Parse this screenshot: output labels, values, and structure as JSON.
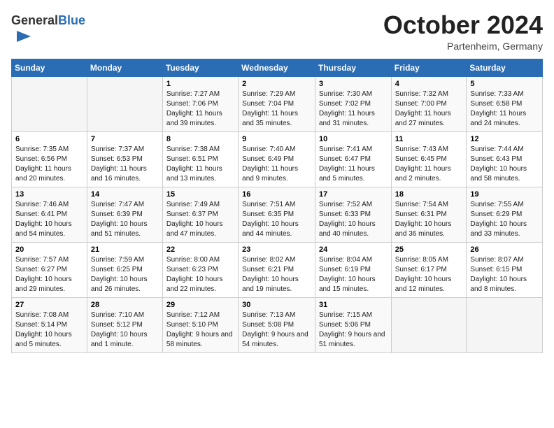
{
  "header": {
    "logo_general": "General",
    "logo_blue": "Blue",
    "month": "October 2024",
    "location": "Partenheim, Germany"
  },
  "weekdays": [
    "Sunday",
    "Monday",
    "Tuesday",
    "Wednesday",
    "Thursday",
    "Friday",
    "Saturday"
  ],
  "rows": [
    [
      {
        "day": "",
        "sunrise": "",
        "sunset": "",
        "daylight": ""
      },
      {
        "day": "",
        "sunrise": "",
        "sunset": "",
        "daylight": ""
      },
      {
        "day": "1",
        "sunrise": "Sunrise: 7:27 AM",
        "sunset": "Sunset: 7:06 PM",
        "daylight": "Daylight: 11 hours and 39 minutes."
      },
      {
        "day": "2",
        "sunrise": "Sunrise: 7:29 AM",
        "sunset": "Sunset: 7:04 PM",
        "daylight": "Daylight: 11 hours and 35 minutes."
      },
      {
        "day": "3",
        "sunrise": "Sunrise: 7:30 AM",
        "sunset": "Sunset: 7:02 PM",
        "daylight": "Daylight: 11 hours and 31 minutes."
      },
      {
        "day": "4",
        "sunrise": "Sunrise: 7:32 AM",
        "sunset": "Sunset: 7:00 PM",
        "daylight": "Daylight: 11 hours and 27 minutes."
      },
      {
        "day": "5",
        "sunrise": "Sunrise: 7:33 AM",
        "sunset": "Sunset: 6:58 PM",
        "daylight": "Daylight: 11 hours and 24 minutes."
      }
    ],
    [
      {
        "day": "6",
        "sunrise": "Sunrise: 7:35 AM",
        "sunset": "Sunset: 6:56 PM",
        "daylight": "Daylight: 11 hours and 20 minutes."
      },
      {
        "day": "7",
        "sunrise": "Sunrise: 7:37 AM",
        "sunset": "Sunset: 6:53 PM",
        "daylight": "Daylight: 11 hours and 16 minutes."
      },
      {
        "day": "8",
        "sunrise": "Sunrise: 7:38 AM",
        "sunset": "Sunset: 6:51 PM",
        "daylight": "Daylight: 11 hours and 13 minutes."
      },
      {
        "day": "9",
        "sunrise": "Sunrise: 7:40 AM",
        "sunset": "Sunset: 6:49 PM",
        "daylight": "Daylight: 11 hours and 9 minutes."
      },
      {
        "day": "10",
        "sunrise": "Sunrise: 7:41 AM",
        "sunset": "Sunset: 6:47 PM",
        "daylight": "Daylight: 11 hours and 5 minutes."
      },
      {
        "day": "11",
        "sunrise": "Sunrise: 7:43 AM",
        "sunset": "Sunset: 6:45 PM",
        "daylight": "Daylight: 11 hours and 2 minutes."
      },
      {
        "day": "12",
        "sunrise": "Sunrise: 7:44 AM",
        "sunset": "Sunset: 6:43 PM",
        "daylight": "Daylight: 10 hours and 58 minutes."
      }
    ],
    [
      {
        "day": "13",
        "sunrise": "Sunrise: 7:46 AM",
        "sunset": "Sunset: 6:41 PM",
        "daylight": "Daylight: 10 hours and 54 minutes."
      },
      {
        "day": "14",
        "sunrise": "Sunrise: 7:47 AM",
        "sunset": "Sunset: 6:39 PM",
        "daylight": "Daylight: 10 hours and 51 minutes."
      },
      {
        "day": "15",
        "sunrise": "Sunrise: 7:49 AM",
        "sunset": "Sunset: 6:37 PM",
        "daylight": "Daylight: 10 hours and 47 minutes."
      },
      {
        "day": "16",
        "sunrise": "Sunrise: 7:51 AM",
        "sunset": "Sunset: 6:35 PM",
        "daylight": "Daylight: 10 hours and 44 minutes."
      },
      {
        "day": "17",
        "sunrise": "Sunrise: 7:52 AM",
        "sunset": "Sunset: 6:33 PM",
        "daylight": "Daylight: 10 hours and 40 minutes."
      },
      {
        "day": "18",
        "sunrise": "Sunrise: 7:54 AM",
        "sunset": "Sunset: 6:31 PM",
        "daylight": "Daylight: 10 hours and 36 minutes."
      },
      {
        "day": "19",
        "sunrise": "Sunrise: 7:55 AM",
        "sunset": "Sunset: 6:29 PM",
        "daylight": "Daylight: 10 hours and 33 minutes."
      }
    ],
    [
      {
        "day": "20",
        "sunrise": "Sunrise: 7:57 AM",
        "sunset": "Sunset: 6:27 PM",
        "daylight": "Daylight: 10 hours and 29 minutes."
      },
      {
        "day": "21",
        "sunrise": "Sunrise: 7:59 AM",
        "sunset": "Sunset: 6:25 PM",
        "daylight": "Daylight: 10 hours and 26 minutes."
      },
      {
        "day": "22",
        "sunrise": "Sunrise: 8:00 AM",
        "sunset": "Sunset: 6:23 PM",
        "daylight": "Daylight: 10 hours and 22 minutes."
      },
      {
        "day": "23",
        "sunrise": "Sunrise: 8:02 AM",
        "sunset": "Sunset: 6:21 PM",
        "daylight": "Daylight: 10 hours and 19 minutes."
      },
      {
        "day": "24",
        "sunrise": "Sunrise: 8:04 AM",
        "sunset": "Sunset: 6:19 PM",
        "daylight": "Daylight: 10 hours and 15 minutes."
      },
      {
        "day": "25",
        "sunrise": "Sunrise: 8:05 AM",
        "sunset": "Sunset: 6:17 PM",
        "daylight": "Daylight: 10 hours and 12 minutes."
      },
      {
        "day": "26",
        "sunrise": "Sunrise: 8:07 AM",
        "sunset": "Sunset: 6:15 PM",
        "daylight": "Daylight: 10 hours and 8 minutes."
      }
    ],
    [
      {
        "day": "27",
        "sunrise": "Sunrise: 7:08 AM",
        "sunset": "Sunset: 5:14 PM",
        "daylight": "Daylight: 10 hours and 5 minutes."
      },
      {
        "day": "28",
        "sunrise": "Sunrise: 7:10 AM",
        "sunset": "Sunset: 5:12 PM",
        "daylight": "Daylight: 10 hours and 1 minute."
      },
      {
        "day": "29",
        "sunrise": "Sunrise: 7:12 AM",
        "sunset": "Sunset: 5:10 PM",
        "daylight": "Daylight: 9 hours and 58 minutes."
      },
      {
        "day": "30",
        "sunrise": "Sunrise: 7:13 AM",
        "sunset": "Sunset: 5:08 PM",
        "daylight": "Daylight: 9 hours and 54 minutes."
      },
      {
        "day": "31",
        "sunrise": "Sunrise: 7:15 AM",
        "sunset": "Sunset: 5:06 PM",
        "daylight": "Daylight: 9 hours and 51 minutes."
      },
      {
        "day": "",
        "sunrise": "",
        "sunset": "",
        "daylight": ""
      },
      {
        "day": "",
        "sunrise": "",
        "sunset": "",
        "daylight": ""
      }
    ]
  ]
}
